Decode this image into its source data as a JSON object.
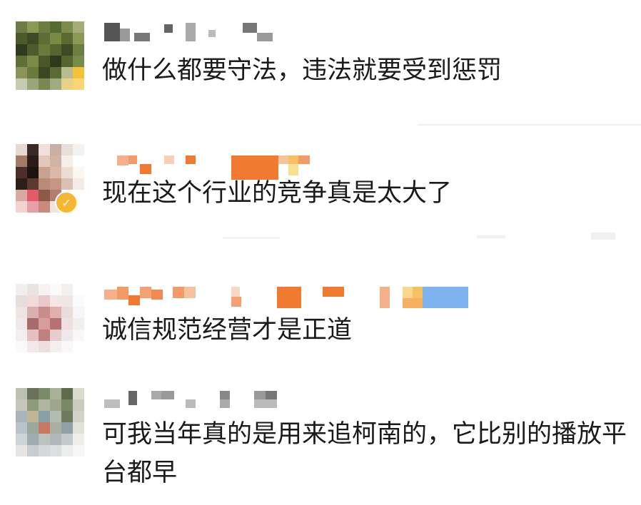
{
  "comments": [
    {
      "text": "做什么都要守法，违法就要受到惩罚"
    },
    {
      "text": "现在这个行业的竞争真是太大了"
    },
    {
      "text": "诚信规范经营才是正道"
    },
    {
      "text": "可我当年真的是用来追柯南的，它比别的播放平台都早"
    }
  ],
  "colors": {
    "text": "#1a1a1a",
    "badge": "#f5b731",
    "username_orange": "#f07a2c",
    "username_blue": "#7fb3f0"
  },
  "icons": [
    "verified-badge-icon"
  ]
}
